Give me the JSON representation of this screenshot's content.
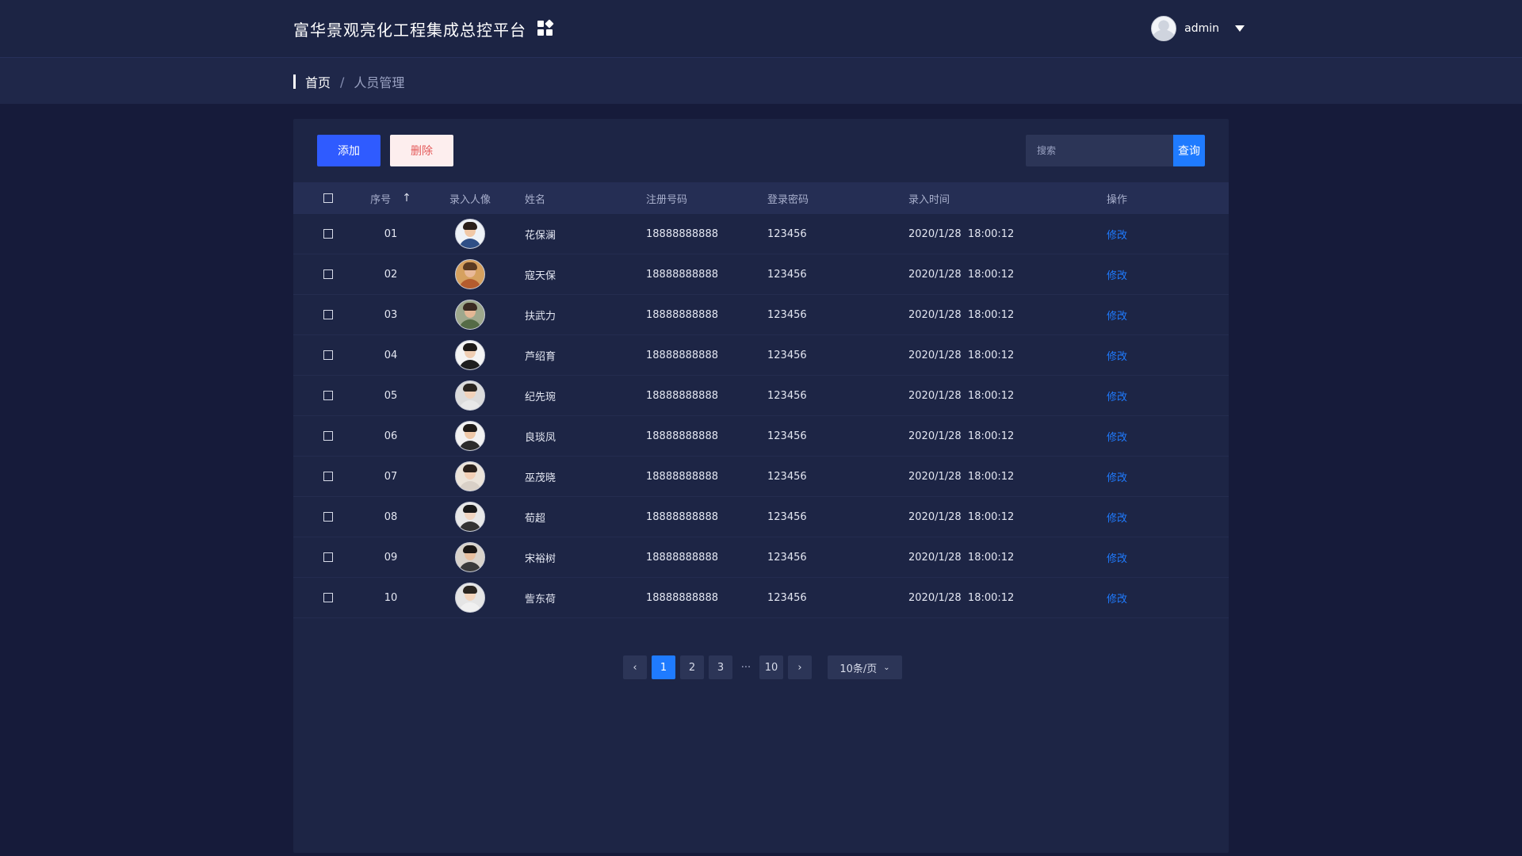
{
  "header": {
    "title": "富华景观亮化工程集成总控平台",
    "user_name": "admin"
  },
  "breadcrumb": {
    "home": "首页",
    "separator": "/",
    "current": "人员管理"
  },
  "toolbar": {
    "add_label": "添加",
    "delete_label": "删除",
    "search_placeholder": "搜索",
    "search_button": "查询"
  },
  "table": {
    "columns": [
      "序号",
      "录入人像",
      "姓名",
      "注册号码",
      "登录密码",
      "录入时间",
      "操作"
    ],
    "sort_icon": "arrow-up-icon",
    "rows": [
      {
        "idx": "01",
        "name": "花保澜",
        "phone": "18888888888",
        "password": "123456",
        "time": "2020/1/28  18:00:12",
        "action": "修改"
      },
      {
        "idx": "02",
        "name": "寇天保",
        "phone": "18888888888",
        "password": "123456",
        "time": "2020/1/28  18:00:12",
        "action": "修改"
      },
      {
        "idx": "03",
        "name": "扶武力",
        "phone": "18888888888",
        "password": "123456",
        "time": "2020/1/28  18:00:12",
        "action": "修改"
      },
      {
        "idx": "04",
        "name": "芦绍育",
        "phone": "18888888888",
        "password": "123456",
        "time": "2020/1/28  18:00:12",
        "action": "修改"
      },
      {
        "idx": "05",
        "name": "纪先琬",
        "phone": "18888888888",
        "password": "123456",
        "time": "2020/1/28  18:00:12",
        "action": "修改"
      },
      {
        "idx": "06",
        "name": "良琰凤",
        "phone": "18888888888",
        "password": "123456",
        "time": "2020/1/28  18:00:12",
        "action": "修改"
      },
      {
        "idx": "07",
        "name": "巫茂晓",
        "phone": "18888888888",
        "password": "123456",
        "time": "2020/1/28  18:00:12",
        "action": "修改"
      },
      {
        "idx": "08",
        "name": "荀超",
        "phone": "18888888888",
        "password": "123456",
        "time": "2020/1/28  18:00:12",
        "action": "修改"
      },
      {
        "idx": "09",
        "name": "宋裕树",
        "phone": "18888888888",
        "password": "123456",
        "time": "2020/1/28  18:00:12",
        "action": "修改"
      },
      {
        "idx": "10",
        "name": "訾东荷",
        "phone": "18888888888",
        "password": "123456",
        "time": "2020/1/28  18:00:12",
        "action": "修改"
      }
    ]
  },
  "pagination": {
    "prev": "‹",
    "pages": [
      "1",
      "2",
      "3"
    ],
    "ellipsis": "···",
    "last": "10",
    "next": "›",
    "current_page": "1",
    "page_size": "10条/页"
  },
  "colors": {
    "background": "#161b3a",
    "panel": "#1d2545",
    "primary": "#2f5bff",
    "link": "#1f7bff",
    "danger": "#e45a5a"
  }
}
